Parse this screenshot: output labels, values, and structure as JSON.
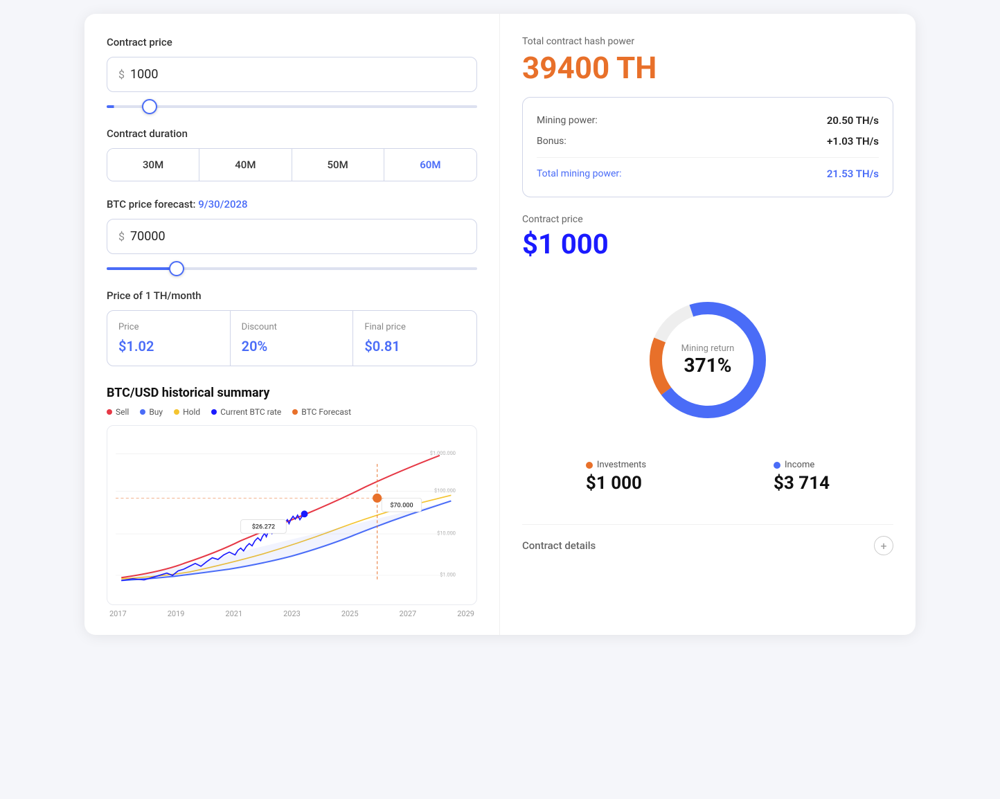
{
  "left": {
    "contract_price_label": "Contract price",
    "contract_price_value": "1000",
    "currency_symbol": "$",
    "contract_duration_label": "Contract duration",
    "duration_options": [
      "30M",
      "40M",
      "50M",
      "60M"
    ],
    "active_duration_index": 3,
    "btc_forecast_label": "BTC price forecast:",
    "btc_forecast_date": "9/30/2028",
    "btc_price_value": "70000",
    "th_price_label": "Price of 1 TH/month",
    "th_cells": [
      {
        "label": "Price",
        "value": "$1.02"
      },
      {
        "label": "Discount",
        "value": "20%"
      },
      {
        "label": "Final price",
        "value": "$0.81"
      }
    ],
    "chart": {
      "title": "BTC/USD historical summary",
      "legend": [
        {
          "label": "Sell",
          "color": "#e63946"
        },
        {
          "label": "Buy",
          "color": "#4a6cf7"
        },
        {
          "label": "Hold",
          "color": "#f4c430"
        },
        {
          "label": "Current BTC rate",
          "color": "#1a1aff"
        },
        {
          "label": "BTC Forecast",
          "color": "#e8702a"
        }
      ],
      "y_labels": [
        "$1.000.000",
        "$100.000",
        "$10.000",
        "$1.000"
      ],
      "x_labels": [
        "2017",
        "2019",
        "2021",
        "2023",
        "2025",
        "2027",
        "2029"
      ],
      "callout_current": "$26.272",
      "callout_forecast": "$70.000"
    }
  },
  "right": {
    "hash_power_label": "Total contract hash power",
    "hash_power_value": "39400 TH",
    "mining_details": {
      "mining_power_label": "Mining power:",
      "mining_power_value": "20.50 TH/s",
      "bonus_label": "Bonus:",
      "bonus_value": "+1.03 TH/s",
      "total_label": "Total mining power:",
      "total_value": "21.53 TH/s"
    },
    "contract_price_label": "Contract price",
    "contract_price_value": "$1 000",
    "donut": {
      "center_label": "Mining return",
      "center_value": "371%"
    },
    "investments_label": "Investments",
    "investments_value": "$1 000",
    "income_label": "Income",
    "income_value": "$3 714",
    "investments_color": "#e8702a",
    "income_color": "#4a6cf7",
    "contract_details_label": "Contract details"
  }
}
